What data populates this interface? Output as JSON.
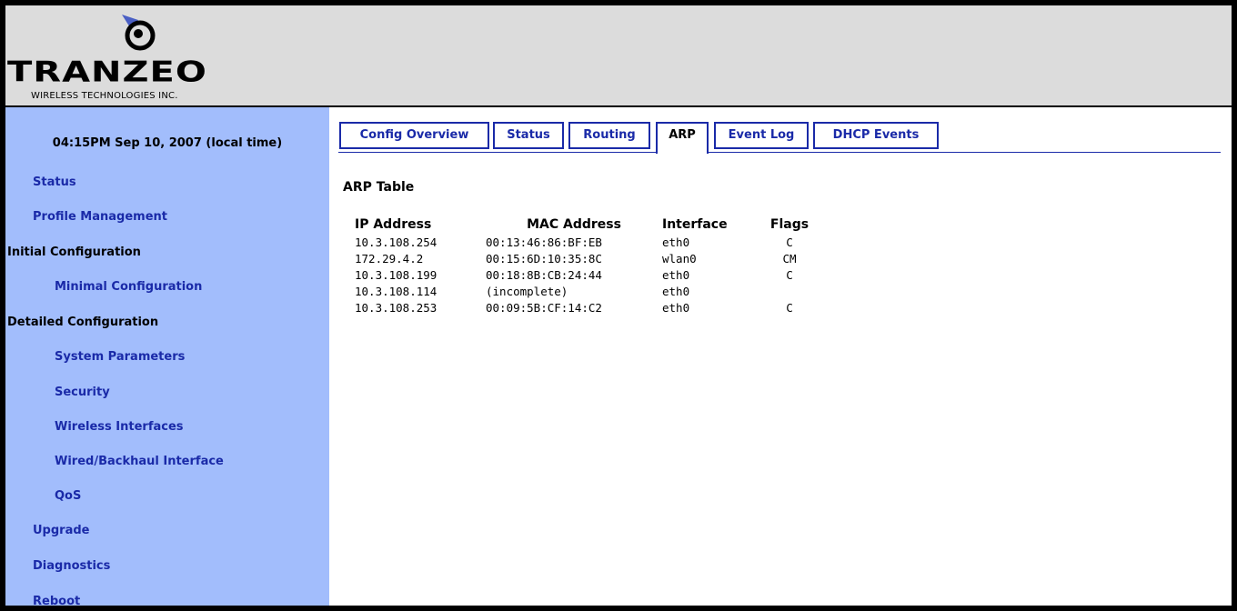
{
  "logo": {
    "wordmark": "TRANZEO",
    "tagline": "WIRELESS TECHNOLOGIES INC."
  },
  "sidebar": {
    "datetime": "04:15PM Sep 10, 2007 (local time)",
    "items": [
      {
        "label": "Status"
      },
      {
        "label": "Profile Management"
      },
      {
        "label": "Initial Configuration"
      },
      {
        "label": "Minimal Configuration"
      },
      {
        "label": "Detailed Configuration"
      },
      {
        "label": "System Parameters"
      },
      {
        "label": "Security"
      },
      {
        "label": "Wireless Interfaces"
      },
      {
        "label": "Wired/Backhaul Interface"
      },
      {
        "label": "QoS"
      },
      {
        "label": "Upgrade"
      },
      {
        "label": "Diagnostics"
      },
      {
        "label": "Reboot"
      }
    ]
  },
  "tabs": [
    {
      "label": "Config Overview"
    },
    {
      "label": "Status"
    },
    {
      "label": "Routing"
    },
    {
      "label": "ARP",
      "active": true
    },
    {
      "label": "Event Log"
    },
    {
      "label": "DHCP Events"
    }
  ],
  "main": {
    "title": "ARP Table",
    "columns": [
      "IP Address",
      "MAC Address",
      "Interface",
      "Flags"
    ],
    "rows": [
      [
        "10.3.108.254",
        "00:13:46:86:BF:EB",
        "eth0",
        "C"
      ],
      [
        "172.29.4.2",
        "00:15:6D:10:35:8C",
        "wlan0",
        "CM"
      ],
      [
        "10.3.108.199",
        "00:18:8B:CB:24:44",
        "eth0",
        "C"
      ],
      [
        "10.3.108.114",
        "(incomplete)",
        "eth0",
        ""
      ],
      [
        "10.3.108.253",
        "00:09:5B:CF:14:C2",
        "eth0",
        "C"
      ]
    ]
  },
  "colors": {
    "sidebar_bg": "#a2bdfc",
    "link": "#1a2aa8",
    "header_bg": "#dcdcdc",
    "logo_accent": "#4a5fc4"
  }
}
